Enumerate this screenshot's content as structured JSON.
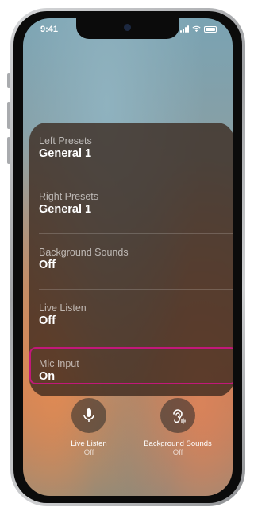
{
  "status_bar": {
    "time": "9:41"
  },
  "hearing_panel": {
    "items": [
      {
        "label": "Left Presets",
        "value": "General 1"
      },
      {
        "label": "Right Presets",
        "value": "General 1"
      },
      {
        "label": "Background Sounds",
        "value": "Off"
      },
      {
        "label": "Live Listen",
        "value": "Off"
      },
      {
        "label": "Mic Input",
        "value": "On"
      }
    ],
    "highlighted_item": "Mic Input",
    "highlight_color": "#c2187a"
  },
  "controls": [
    {
      "icon": "microphone-icon",
      "label": "Live Listen",
      "status": "Off"
    },
    {
      "icon": "ear-sound-icon",
      "label": "Background Sounds",
      "status": "Off"
    }
  ]
}
